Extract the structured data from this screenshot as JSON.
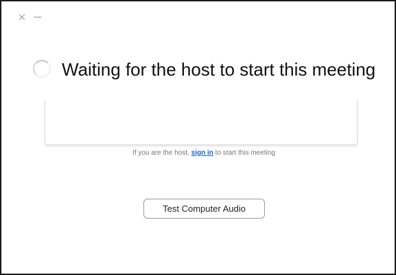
{
  "titlebar": {
    "close_icon": "close-icon",
    "minimize_icon": "minimize-icon"
  },
  "main": {
    "spinner_icon": "loading-spinner-icon",
    "heading": "Waiting for the host to start this meeting",
    "host_hint": {
      "prefix": "If you are the host, ",
      "link": "sign in",
      "suffix": " to start this meeting"
    },
    "test_audio_label": "Test Computer Audio"
  },
  "colors": {
    "link": "#1b5fc7",
    "hint_text": "#747474",
    "heading_text": "#111111"
  }
}
